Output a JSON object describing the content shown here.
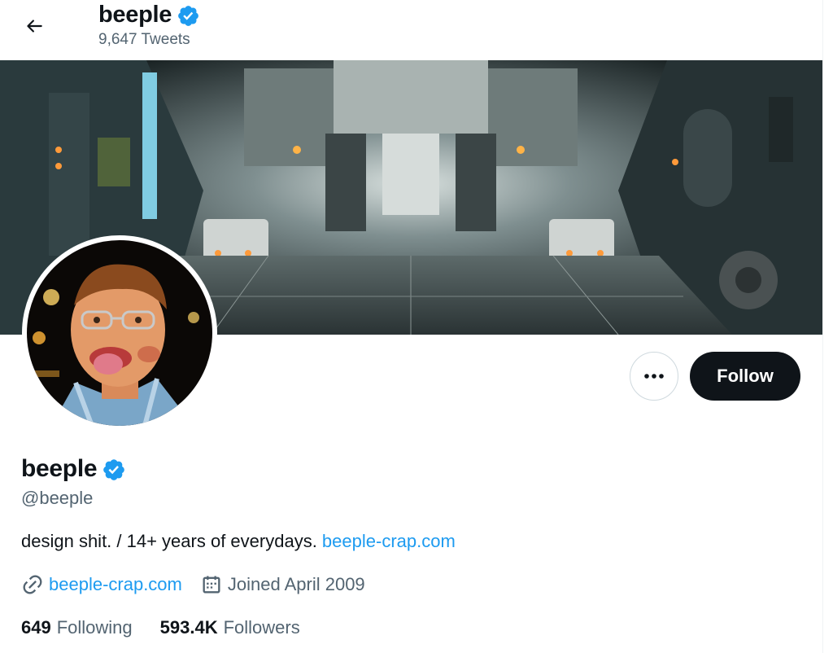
{
  "header": {
    "name": "beeple",
    "tweet_count": "9,647 Tweets"
  },
  "profile": {
    "name": "beeple",
    "handle": "@beeple",
    "bio_text": "design shit. / 14+ years of everydays. ",
    "bio_link": "beeple-crap.com",
    "website": "beeple-crap.com",
    "joined": "Joined April 2009",
    "following_count": "649",
    "following_label": "Following",
    "followers_count": "593.4K",
    "followers_label": "Followers",
    "verified": true
  },
  "actions": {
    "follow_label": "Follow"
  },
  "icons": {
    "back": "arrow-left-icon",
    "verified": "verified-badge-icon",
    "more": "more-dots-icon",
    "link": "link-icon",
    "calendar": "calendar-icon"
  },
  "colors": {
    "accent": "#1d9bf0",
    "text": "#0f1419",
    "secondary": "#536471",
    "follow_bg": "#0f1419"
  }
}
